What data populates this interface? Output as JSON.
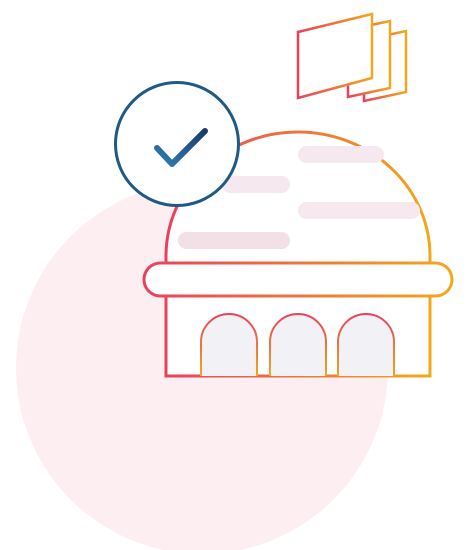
{
  "illustration": {
    "subject": "capitol-building-with-flag-and-checkmark",
    "icons": [
      "check-icon",
      "flag-icon",
      "dome-icon"
    ],
    "colors": {
      "background": "#ffffff",
      "blob": "#fdeef2",
      "gradient_start": "#e8415e",
      "gradient_end": "#f2a81d",
      "badge_stroke": "#1f5a86",
      "check_dark": "#1b3a6b",
      "check_light": "#2f7fb5",
      "window_fill": "#f2f1f6",
      "dome_bar_left": "#f3dfe6",
      "dome_bar_right": "#f5e8ee"
    }
  }
}
